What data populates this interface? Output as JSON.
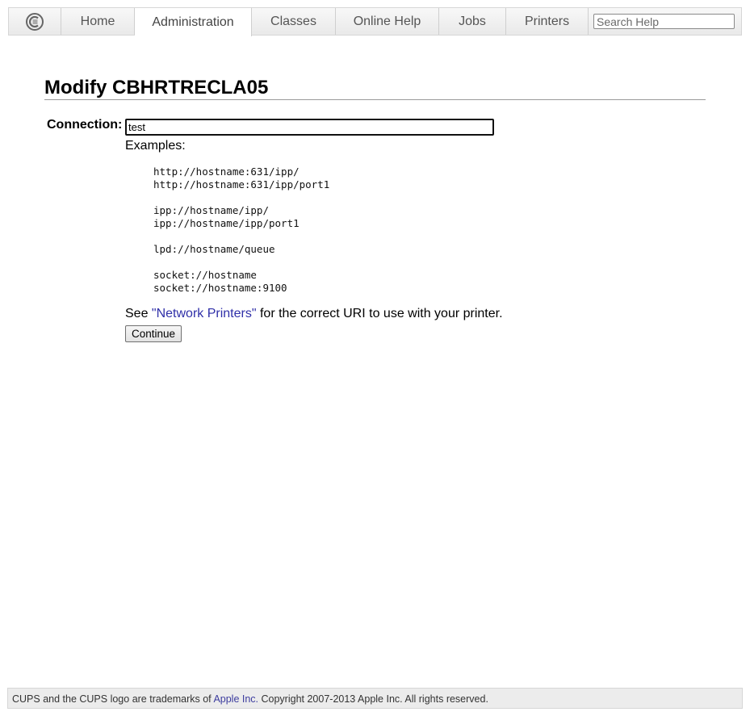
{
  "nav": {
    "logo_icon": "cups-logo-icon",
    "tabs": [
      {
        "label": "Home",
        "active": false
      },
      {
        "label": "Administration",
        "active": true
      },
      {
        "label": "Classes",
        "active": false
      },
      {
        "label": "Online Help",
        "active": false
      },
      {
        "label": "Jobs",
        "active": false
      },
      {
        "label": "Printers",
        "active": false
      }
    ],
    "search_placeholder": "Search Help"
  },
  "main": {
    "title": "Modify CBHRTRECLA05",
    "connection_label": "Connection:",
    "connection_value": "test",
    "examples_label": "Examples:",
    "example_groups": [
      [
        "http://hostname:631/ipp/",
        "http://hostname:631/ipp/port1"
      ],
      [
        "ipp://hostname/ipp/",
        "ipp://hostname/ipp/port1"
      ],
      [
        "lpd://hostname/queue"
      ],
      [
        "socket://hostname",
        "socket://hostname:9100"
      ]
    ],
    "hint_prefix": "See ",
    "hint_link": "\"Network Printers\"",
    "hint_suffix": " for the correct URI to use with your printer.",
    "continue_label": "Continue"
  },
  "footer": {
    "prefix": "CUPS and the CUPS logo are trademarks of ",
    "link": "Apple Inc.",
    "suffix": " Copyright 2007-2013 Apple Inc. All rights reserved."
  },
  "colors": {
    "link": "#2f2fa8",
    "nav_text": "#555555",
    "footer_bg": "#ececec"
  }
}
